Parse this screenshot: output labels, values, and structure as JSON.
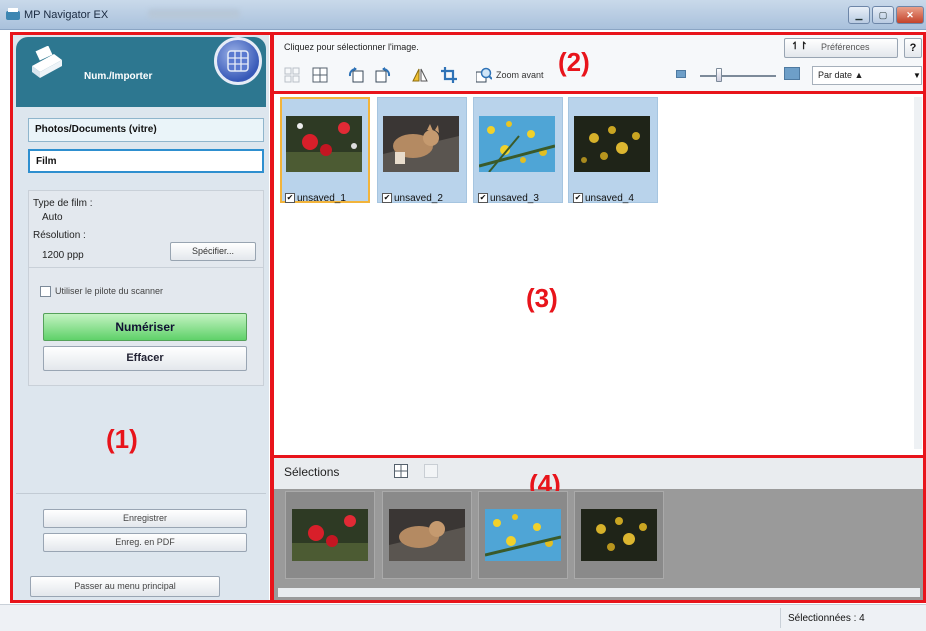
{
  "window": {
    "title": "MP Navigator EX",
    "controls": [
      "minimize",
      "maximize",
      "close"
    ]
  },
  "left_panel": {
    "mode_title": "Num./Importer",
    "sources": [
      "Photos/Documents (vitre)",
      "Film"
    ],
    "selected_source": "Film",
    "film_type_label": "Type de film :",
    "film_type_value": "Auto",
    "resolution_label": "Résolution :",
    "resolution_value": "1200 ppp",
    "specify_button": "Spécifier...",
    "use_driver_label": "Utiliser le pilote du scanner",
    "scan_button": "Numériser",
    "clear_button": "Effacer",
    "save_button": "Enregistrer",
    "save_pdf_button": "Enreg. en PDF",
    "main_menu_button": "Passer au menu principal"
  },
  "toolbar": {
    "hint": "Cliquez pour sélectionner l'image.",
    "preferences_button": "Préférences",
    "preferences_icon_text": "↿↾",
    "help_button": "?",
    "zoom_label": "Zoom avant",
    "sort_value": "Par date ▲",
    "icons": [
      "select-all-icon",
      "grid-view-icon",
      "rotate-left-icon",
      "rotate-right-icon",
      "mirror-icon",
      "crop-icon",
      "zoom-in-icon"
    ]
  },
  "thumbnails": [
    {
      "name": "unsaved_1",
      "checked": true,
      "check_mark": "✔"
    },
    {
      "name": "unsaved_2",
      "checked": true,
      "check_mark": "✔"
    },
    {
      "name": "unsaved_3",
      "checked": true,
      "check_mark": "✔"
    },
    {
      "name": "unsaved_4",
      "checked": true,
      "check_mark": "✔"
    }
  ],
  "selections": {
    "title": "Sélections"
  },
  "callouts": {
    "one": "(1)",
    "two": "(2)",
    "three": "(3)",
    "four": "(4)"
  },
  "status": {
    "selected_text": "Sélectionnées : 4"
  },
  "colors": {
    "accent_red": "#e8141b",
    "header_teal": "#2d7790",
    "scan_green": "#5fd169"
  }
}
